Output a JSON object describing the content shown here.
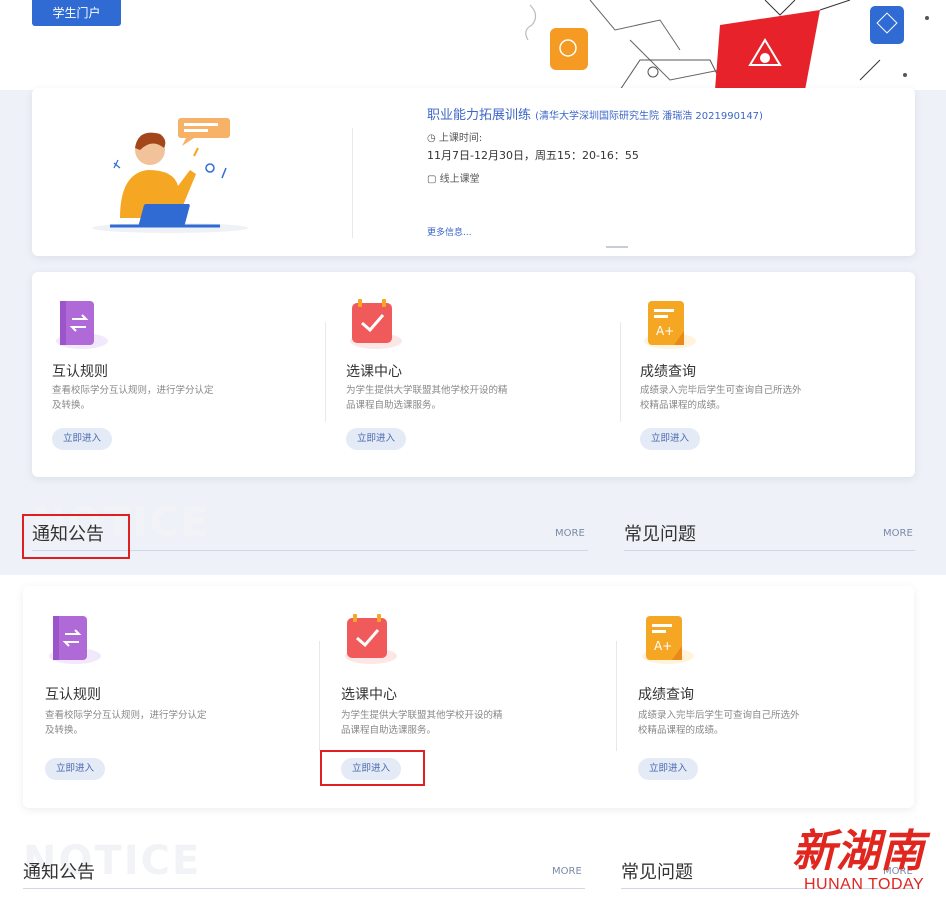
{
  "header": {
    "portal_button": "学生门户"
  },
  "course": {
    "title": "职业能力拓展训练",
    "subtitle": "(清华大学深圳国际研究生院 潘瑞浩 2021990147)",
    "time_label": "上课时间:",
    "time_value": "11月7日-12月30日，周五15：20-16：55",
    "mode": "线上课堂",
    "more": "更多信息..."
  },
  "features_top": [
    {
      "title": "互认规则",
      "desc": "查看校际学分互认规则，进行学分认定及转换。",
      "button": "立即进入"
    },
    {
      "title": "选课中心",
      "desc": "为学生提供大学联盟其他学校开设的精品课程自助选课服务。",
      "button": "立即进入"
    },
    {
      "title": "成绩查询",
      "desc": "成绩录入完毕后学生可查询自己所选外校精品课程的成绩。",
      "button": "立即进入"
    }
  ],
  "features_bottom": [
    {
      "title": "互认规则",
      "desc": "查看校际学分互认规则，进行学分认定及转换。",
      "button": "立即进入"
    },
    {
      "title": "选课中心",
      "desc": "为学生提供大学联盟其他学校开设的精品课程自助选课服务。",
      "button": "立即进入"
    },
    {
      "title": "成绩查询",
      "desc": "成绩录入完毕后学生可查询自己所选外校精品课程的成绩。",
      "button": "立即进入"
    }
  ],
  "sections_top": {
    "notice": "通知公告",
    "faq": "常见问题",
    "more": "MORE",
    "watermark": "NOTICE"
  },
  "sections_bottom": {
    "notice": "通知公告",
    "faq": "常见问题",
    "more": "MORE",
    "watermark": "NOTICE"
  },
  "brand": {
    "cn": "新湖南",
    "en": "HUNAN TODAY"
  },
  "colors": {
    "accent": "#2f6bd3",
    "highlight_box": "#e02020",
    "brand_red": "#e0261f"
  }
}
